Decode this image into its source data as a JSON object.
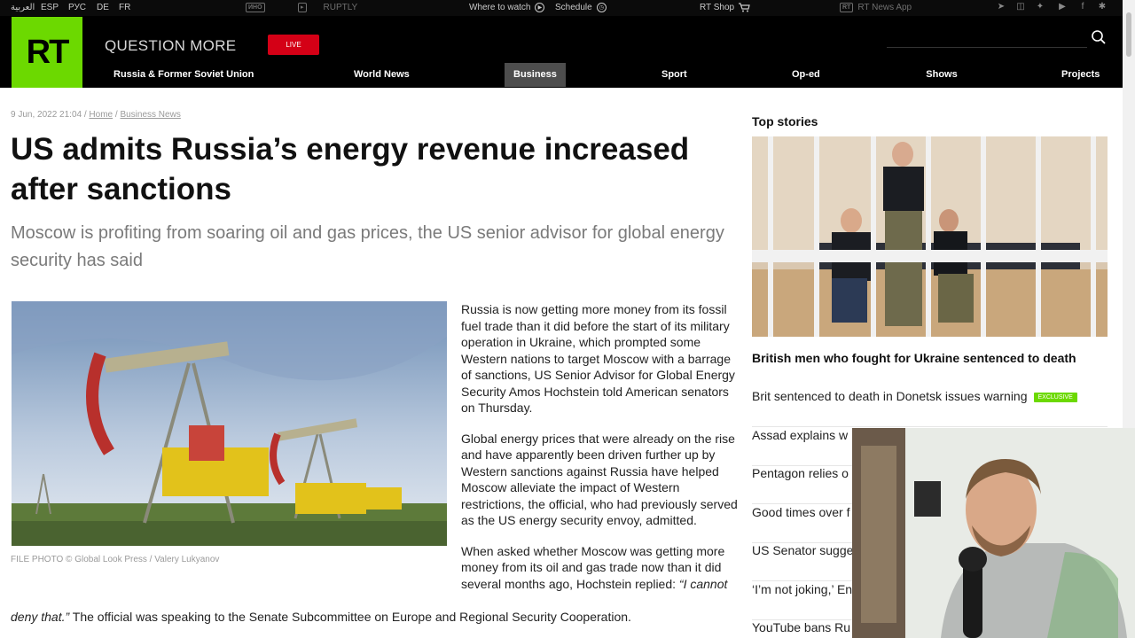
{
  "topbar": {
    "languages": [
      "العربية",
      "ESP",
      "РУС",
      "DE",
      "FR"
    ],
    "ino_tv": "ИНО",
    "ruptly": "RUPTLY",
    "where_to_watch": "Where to watch",
    "schedule": "Schedule",
    "rt_shop": "RT Shop",
    "news_app": "RT News App",
    "social_icons": [
      "telegram-icon",
      "rss-icon",
      "twitter-icon",
      "youtube-icon",
      "facebook-icon",
      "settings-icon"
    ]
  },
  "header": {
    "logo": "RT",
    "tagline": "QUESTION MORE",
    "live": "LIVE",
    "nav": [
      "Russia & Former Soviet Union",
      "World News",
      "Business",
      "Sport",
      "Op-ed",
      "Shows",
      "Projects"
    ],
    "active_nav": "Business"
  },
  "article": {
    "date": "9 Jun, 2022 21:04",
    "breadcrumb": [
      "Home",
      "Business News"
    ],
    "headline": "US admits Russia’s energy revenue increased after sanctions",
    "standfirst": "Moscow is profiting from soaring oil and gas prices, the US senior advisor for global energy security has said",
    "caption": "FILE PHOTO © Global Look Press / Valery Lukyanov",
    "paragraphs": [
      "Russia is now getting more money from its fossil fuel trade than it did before the start of its military operation in Ukraine, which prompted some Western nations to target Moscow with a barrage of sanctions, US Senior Advisor for Global Energy Security Amos Hochstein told American senators on Thursday.",
      "Global energy prices that were already on the rise and have apparently been driven further up by Western sanctions against Russia have helped Moscow alleviate the impact of Western restrictions, the official, who had previously served as the US energy security envoy, admitted."
    ],
    "p3_start": "When asked whether Moscow was getting more money from its oil and gas trade now than it did several months ago, Hochstein replied: ",
    "p3_quote_a": "“I cannot",
    "p3_quote_b": "deny that.”",
    "p3_end": " The official was speaking to the Senate Subcommittee on Europe and Regional Security Cooperation."
  },
  "sidebar": {
    "title": "Top stories",
    "lead": "British men who fought for Ukraine sentenced to death",
    "stories": [
      {
        "text": "Brit sentenced to death in Donetsk issues warning",
        "badge": "EXCLUSIVE"
      },
      {
        "text": "Assad explains w",
        "badge": ""
      },
      {
        "text": "Pentagon relies o",
        "badge": ""
      },
      {
        "text": "Good times over f",
        "badge": ""
      },
      {
        "text": "US Senator sugge",
        "badge": ""
      },
      {
        "text": "‘I’m not joking,’ En",
        "badge": ""
      },
      {
        "text": "YouTube bans Ru",
        "badge": ""
      }
    ]
  },
  "colors": {
    "brand_green": "#6cd900",
    "live_red": "#d40016",
    "header_black": "#000000"
  }
}
